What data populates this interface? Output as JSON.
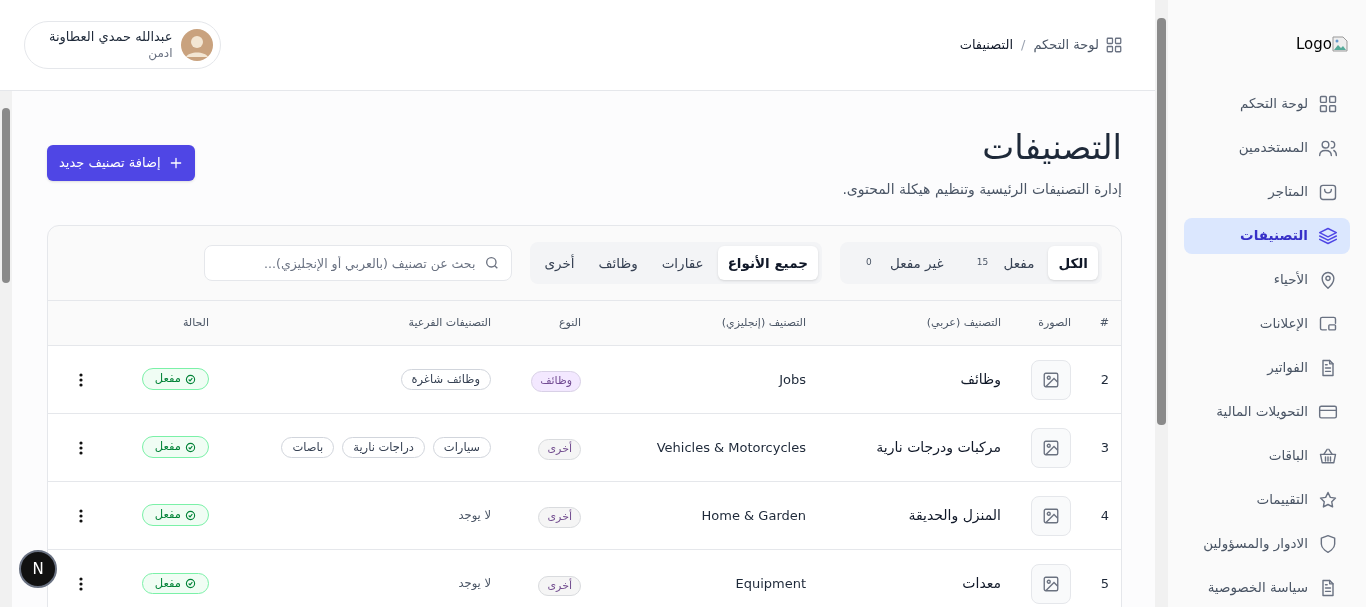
{
  "sidebar": {
    "logo": "Logo",
    "items": [
      {
        "label": "لوحة التحكم",
        "selected": false
      },
      {
        "label": "المستخدمين",
        "selected": false
      },
      {
        "label": "المتاجر",
        "selected": false
      },
      {
        "label": "التصنيفات",
        "selected": true
      },
      {
        "label": "الأحياء",
        "selected": false
      },
      {
        "label": "الإعلانات",
        "selected": false
      },
      {
        "label": "الفواتير",
        "selected": false
      },
      {
        "label": "التحويلات المالية",
        "selected": false
      },
      {
        "label": "الباقات",
        "selected": false
      },
      {
        "label": "التقييمات",
        "selected": false
      },
      {
        "label": "الادوار والمسؤولين",
        "selected": false
      },
      {
        "label": "سياسة الخصوصية",
        "selected": false
      }
    ]
  },
  "header": {
    "breadcrumb": [
      "لوحة التحكم",
      "التصنيفات"
    ],
    "breadcrumb_separator": "/",
    "user": {
      "name": "عبدالله حمدي العطاونة",
      "role": "ادمن"
    }
  },
  "page": {
    "title": "التصنيفات",
    "description": "إدارة التصنيفات الرئيسية وتنظيم هيكلة المحتوى.",
    "add_button": "إضافة تصنيف جديد"
  },
  "status_filter": [
    {
      "label": "الكل",
      "selected": true
    },
    {
      "label": "مفعل",
      "count": "15",
      "selected": false
    },
    {
      "label": "غير مفعل",
      "count": "0",
      "selected": false
    }
  ],
  "type_filter": [
    {
      "label": "جميع الأنواع",
      "selected": true
    },
    {
      "label": "عقارات",
      "selected": false
    },
    {
      "label": "وظائف",
      "selected": false
    },
    {
      "label": "أخرى",
      "selected": false
    }
  ],
  "search": {
    "placeholder": "بحث عن تصنيف (بالعربي أو الإنجليزي)..."
  },
  "table": {
    "columns": [
      "#",
      "الصورة",
      "التصنيف (عربي)",
      "التصنيف (إنجليزي)",
      "النوع",
      "التصنيفات الفرعية",
      "الحالة"
    ],
    "rows": [
      {
        "index": "2",
        "name_ar": "وظائف",
        "name_en": "Jobs",
        "type": {
          "label": "وظائف",
          "color": "#f3e8ff"
        },
        "subcategories": [
          "وظائف شاغرة"
        ],
        "status": {
          "label": "مفعل",
          "active": true
        }
      },
      {
        "index": "3",
        "name_ar": "مركبات ودرجات نارية",
        "name_en": "Vehicles & Motorcycles",
        "type": {
          "label": "أخرى",
          "color": "#f5f5f5"
        },
        "subcategories": [
          "سيارات",
          "دراجات نارية",
          "باصات"
        ],
        "status": {
          "label": "مفعل",
          "active": true
        }
      },
      {
        "index": "4",
        "name_ar": "المنزل والحديقة",
        "name_en": "Home & Garden",
        "type": {
          "label": "أخرى",
          "color": "#f5f5f5"
        },
        "no_subcategories": "لا يوجد",
        "status": {
          "label": "مفعل",
          "active": true
        }
      },
      {
        "index": "5",
        "name_ar": "معدات",
        "name_en": "Equipment",
        "type": {
          "label": "أخرى",
          "color": "#f5f5f5"
        },
        "no_subcategories": "لا يوجد",
        "status": {
          "label": "مفعل",
          "active": true
        }
      }
    ]
  },
  "dev_badge": "N"
}
